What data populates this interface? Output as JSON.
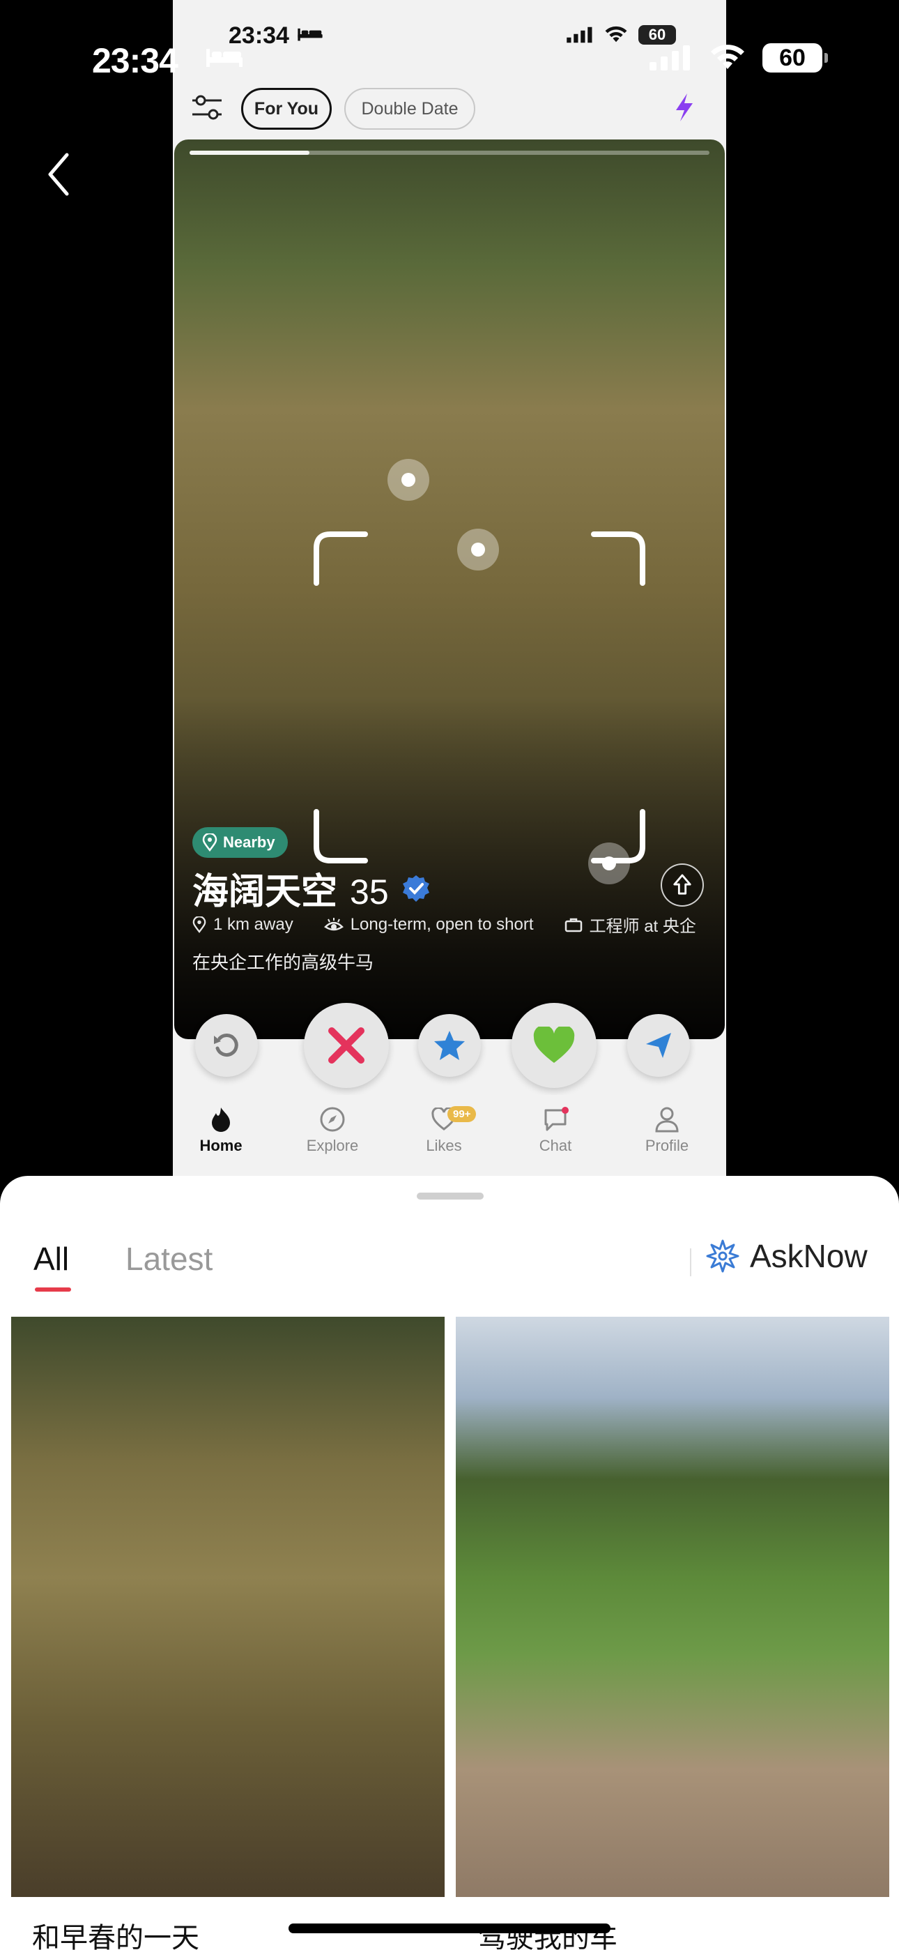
{
  "outer_status": {
    "time": "23:34",
    "battery": "60"
  },
  "app": {
    "status": {
      "time": "23:34",
      "battery": "60"
    },
    "topbar": {
      "chip_active": "For You",
      "chip_inactive": "Double Date"
    },
    "card": {
      "photo_progress": 0.23,
      "nearby_label": "Nearby",
      "name": "海阔天空",
      "age": "35",
      "distance": "1 km away",
      "intent": "Long-term, open to short",
      "job": "工程师 at 央企",
      "bio": "在央企工作的高级牛马"
    },
    "actions": [
      "rewind-icon",
      "nope-icon",
      "super-like-icon",
      "like-icon",
      "boost-icon"
    ],
    "tabs": [
      {
        "label": "Home",
        "active": true
      },
      {
        "label": "Explore",
        "active": false
      },
      {
        "label": "Likes",
        "active": false,
        "badge": "99+"
      },
      {
        "label": "Chat",
        "active": false
      },
      {
        "label": "Profile",
        "active": false
      }
    ]
  },
  "sheet": {
    "tab_all": "All",
    "tab_latest": "Latest",
    "asknow": "AskNow",
    "results": [
      {
        "caption": "和早春的一天"
      },
      {
        "caption": "驾驶我的车"
      }
    ]
  },
  "colors": {
    "accent_red": "#e63b4a",
    "nearby_green": "#2e8b72",
    "asknow_blue": "#3a7bd5",
    "bolt_purple": "#8a3ff0"
  }
}
